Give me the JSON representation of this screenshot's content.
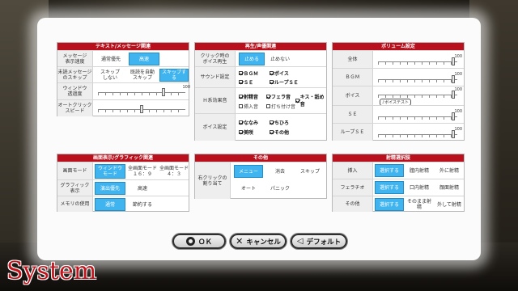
{
  "screen_title": "System",
  "text": {
    "header": "テキスト/メッセージ関連",
    "rows": [
      {
        "label": "メッセージ\n表示速度",
        "options": [
          "通常優先",
          "高速"
        ],
        "selected": 1
      },
      {
        "label": "未読メッセージ\nのスキップ",
        "options": [
          "スキップ\nしない",
          "既読を自動\nスキップ",
          "スキップする"
        ],
        "selected": 2
      },
      {
        "label": "ウィンドウ\n透過度",
        "slider_max": "100",
        "value": 0.75
      },
      {
        "label": "オートクリック\nスピード",
        "value": 0.5
      }
    ]
  },
  "voice": {
    "header": "再生/声優関連",
    "click_label": "クリック時の\nボイス再生",
    "click_options": [
      "止める",
      "止めない"
    ],
    "click_selected": 0,
    "sound_label": "サウンド設定",
    "sound_items": [
      {
        "label": "ＢＧＭ",
        "on": true
      },
      {
        "label": "ボイス",
        "on": true
      },
      {
        "label": "ＳＥ",
        "on": true
      },
      {
        "label": "ループＳＥ",
        "on": true
      }
    ],
    "h_label": "Ｈ系効果音",
    "h_items": [
      {
        "label": "射精音",
        "on": true
      },
      {
        "label": "フェラ音",
        "on": true
      },
      {
        "label": "キス・舐め音",
        "on": true
      },
      {
        "label": "挿入音",
        "on": false
      },
      {
        "label": "打ち付け音",
        "on": false
      }
    ],
    "voice_label": "ボイス設定",
    "voice_items": [
      {
        "label": "ななみ",
        "on": true
      },
      {
        "label": "ちひろ",
        "on": true
      },
      {
        "label": "美咲",
        "on": true
      },
      {
        "label": "その他",
        "on": true
      }
    ]
  },
  "volume": {
    "header": "ボリューム設定",
    "rows": [
      {
        "label": "全体",
        "value": 0.95
      },
      {
        "label": "ＢＧＭ",
        "value": 0.95
      },
      {
        "label": "ボイス",
        "value": 0.95,
        "tip": "♪ボイステスト"
      },
      {
        "label": "ＳＥ",
        "value": 0.95
      },
      {
        "label": "ループＳＥ",
        "value": 0.95
      }
    ],
    "max_label": "100"
  },
  "display": {
    "header": "画面表示/グラフィック関連",
    "rows": [
      {
        "label": "画面モード",
        "options": [
          "ウィンドウ\nモード",
          "全画面モード\n１６：９",
          "全画面モード\n４：３"
        ],
        "selected": 0
      },
      {
        "label": "グラフィック\n表示",
        "options": [
          "演出優先",
          "高速"
        ],
        "selected": 0
      },
      {
        "label": "メモリの使用",
        "options": [
          "通常",
          "節約する"
        ],
        "selected": 0
      }
    ]
  },
  "other": {
    "header": "その他",
    "label": "右クリックの\n割り当て",
    "options": [
      "メニュー",
      "消去",
      "スキップ",
      "オート",
      "パニック"
    ],
    "selected": 0
  },
  "ejac": {
    "header": "射精選択肢",
    "rows": [
      {
        "label": "挿入",
        "options": [
          "選択する",
          "膣内射精",
          "外に射精"
        ],
        "selected": 0
      },
      {
        "label": "フェラチオ",
        "options": [
          "選択する",
          "口内射精",
          "顔面射精"
        ],
        "selected": 0
      },
      {
        "label": "その他",
        "options": [
          "選択する",
          "そのまま射精",
          "外して射精"
        ],
        "selected": 0
      }
    ]
  },
  "buttons": {
    "ok": "ＯＫ",
    "cancel": "キャンセル",
    "default": "デフォルト"
  },
  "colors": {
    "accent": "#b8111d",
    "selected": "#3fb4ef",
    "title": "#c0141d"
  }
}
